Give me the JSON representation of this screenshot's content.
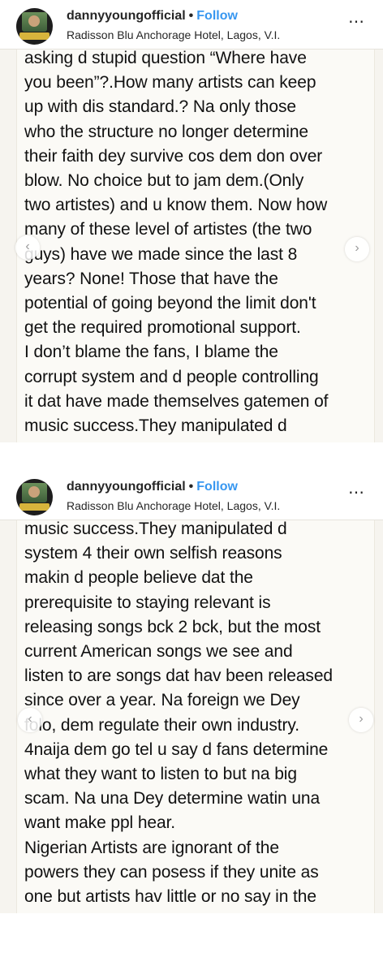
{
  "posts": [
    {
      "username": "dannyyoungofficial",
      "separator": "•",
      "follow_label": "Follow",
      "location": "Radisson Blu Anchorage Hotel, Lagos, V.I.",
      "more_icon": "⋯",
      "prev_icon": "‹",
      "next_icon": "›",
      "lines": [
        "asking d stupid question “Where have",
        "you been”?.How many artists can keep",
        "up with dis standard.? Na only those",
        "who the structure no longer determine",
        "their faith dey survive cos dem don over",
        "blow. No choice but to jam dem.(Only",
        "two artistes) and u know them. Now how",
        "many of these level of artistes (the two",
        "guys) have we made since the last 8",
        "years? None! Those that have the",
        "potential of going beyond the limit don't",
        "get the required promotional support.",
        "I don’t blame the fans, I blame the",
        "corrupt system and d people controlling",
        "it dat have made themselves gatemen of",
        "music success.They manipulated d"
      ]
    },
    {
      "username": "dannyyoungofficial",
      "separator": "•",
      "follow_label": "Follow",
      "location": "Radisson Blu Anchorage Hotel, Lagos, V.I.",
      "more_icon": "⋯",
      "prev_icon": "‹",
      "next_icon": "›",
      "lines": [
        "music success.They manipulated d",
        "system 4 their own selfish reasons",
        "makin d people believe dat the",
        "prerequisite to staying relevant is",
        "releasing songs bck 2 bck, but the most",
        "current American songs we see and",
        "listen to are songs dat hav been released",
        "since over a year. Na foreign we Dey",
        "folo, dem regulate their own industry.",
        "4naija dem go tel u say d fans determine",
        "what they want to listen to but na big",
        "scam. Na una Dey determine watin una",
        "want make ppl hear.",
        "Nigerian Artists are ignorant of the",
        "powers they can posess if they unite as",
        "one but artists hav little or no say in the"
      ]
    }
  ]
}
